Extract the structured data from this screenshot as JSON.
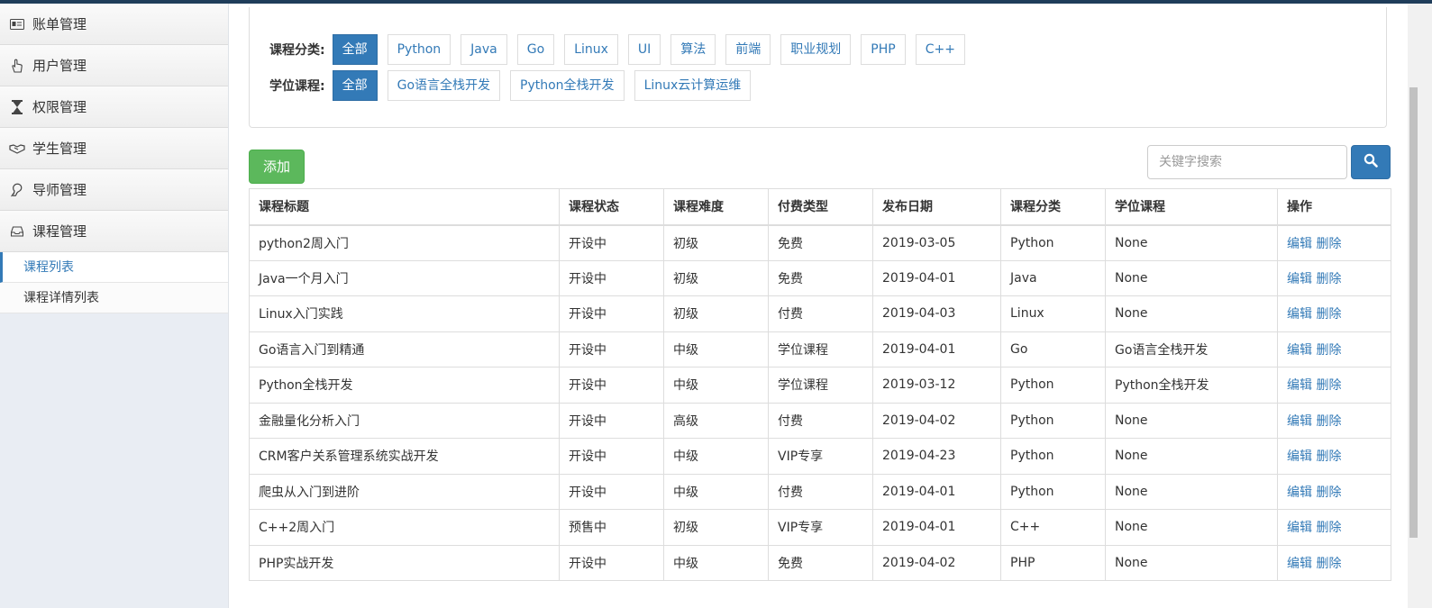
{
  "sidebar": {
    "menus": [
      {
        "label": "账单管理",
        "icon": "id-card-icon"
      },
      {
        "label": "用户管理",
        "icon": "hand-icon"
      },
      {
        "label": "权限管理",
        "icon": "hourglass-icon"
      },
      {
        "label": "学生管理",
        "icon": "handshake-icon"
      },
      {
        "label": "导师管理",
        "icon": "ear-icon"
      },
      {
        "label": "课程管理",
        "icon": "inbox-icon"
      }
    ],
    "submenus": [
      {
        "label": "课程列表",
        "active": true
      },
      {
        "label": "课程详情列表",
        "active": false
      }
    ]
  },
  "filters": {
    "category_label": "课程分类:",
    "categories": [
      "全部",
      "Python",
      "Java",
      "Go",
      "Linux",
      "UI",
      "算法",
      "前端",
      "职业规划",
      "PHP",
      "C++"
    ],
    "degree_label": "学位课程:",
    "degrees": [
      "全部",
      "Go语言全栈开发",
      "Python全栈开发",
      "Linux云计算运维"
    ]
  },
  "toolbar": {
    "add_label": "添加",
    "search_placeholder": "关键字搜索",
    "search_icon": "search-icon"
  },
  "table": {
    "headers": [
      "课程标题",
      "课程状态",
      "课程难度",
      "付费类型",
      "发布日期",
      "课程分类",
      "学位课程",
      "操作"
    ],
    "action_edit": "编辑",
    "action_delete": "删除",
    "rows": [
      [
        "python2周入门",
        "开设中",
        "初级",
        "免费",
        "2019-03-05",
        "Python",
        "None"
      ],
      [
        "Java一个月入门",
        "开设中",
        "初级",
        "免费",
        "2019-04-01",
        "Java",
        "None"
      ],
      [
        "Linux入门实践",
        "开设中",
        "初级",
        "付费",
        "2019-04-03",
        "Linux",
        "None"
      ],
      [
        "Go语言入门到精通",
        "开设中",
        "中级",
        "学位课程",
        "2019-04-01",
        "Go",
        "Go语言全栈开发"
      ],
      [
        "Python全栈开发",
        "开设中",
        "中级",
        "学位课程",
        "2019-03-12",
        "Python",
        "Python全栈开发"
      ],
      [
        "金融量化分析入门",
        "开设中",
        "高级",
        "付费",
        "2019-04-02",
        "Python",
        "None"
      ],
      [
        "CRM客户关系管理系统实战开发",
        "开设中",
        "中级",
        "VIP专享",
        "2019-04-23",
        "Python",
        "None"
      ],
      [
        "爬虫从入门到进阶",
        "开设中",
        "中级",
        "付费",
        "2019-04-01",
        "Python",
        "None"
      ],
      [
        "C++2周入门",
        "预售中",
        "初级",
        "VIP专享",
        "2019-04-01",
        "C++",
        "None"
      ],
      [
        "PHP实战开发",
        "开设中",
        "中级",
        "免费",
        "2019-04-02",
        "PHP",
        "None"
      ]
    ]
  },
  "colors": {
    "primary": "#337ab7",
    "success": "#5cb85c",
    "topbar": "#1f3d5a"
  }
}
